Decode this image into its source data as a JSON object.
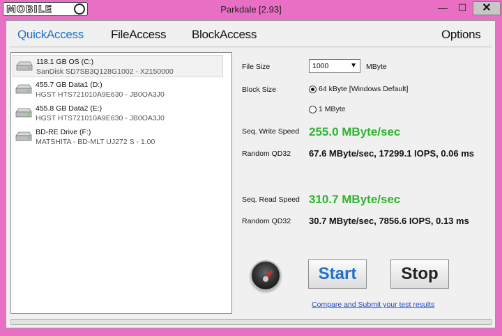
{
  "window": {
    "logo_text": "MOBILE",
    "title": "Parkdale [2.93]",
    "minimize": "—",
    "maximize": "☐",
    "close": "✕"
  },
  "tabs": [
    {
      "label": "QuickAccess",
      "active": true
    },
    {
      "label": "FileAccess"
    },
    {
      "label": "BlockAccess"
    },
    {
      "label": "Options"
    }
  ],
  "drives": [
    {
      "name": "118.1 GB OS (C:)",
      "model": "SanDisk SD7SB3Q128G1002 - X2150000",
      "selected": true
    },
    {
      "name": "455.7 GB Data1 (D:)",
      "model": "HGST HTS721010A9E630 - JB0OA3J0"
    },
    {
      "name": "455.8 GB Data2 (E:)",
      "model": "HGST HTS721010A9E630 - JB0OA3J0"
    },
    {
      "name": "BD-RE Drive (F:)",
      "model": "MATSHITA - BD-MLT UJ272 S - 1.00"
    }
  ],
  "settings": {
    "file_size_label": "File Size",
    "file_size_value": "1000",
    "file_size_unit": "MByte",
    "block_size_label": "Block Size",
    "block_options": [
      {
        "label": "64 kByte [Windows Default]",
        "selected": true
      },
      {
        "label": "1 MByte",
        "selected": false
      }
    ]
  },
  "results": {
    "write_label": "Seq. Write Speed",
    "write_value": "255.0 MByte/sec",
    "write_random_label": "Random QD32",
    "write_random_value": "67.6 MByte/sec, 17299.1 IOPS, 0.06 ms",
    "read_label": "Seq. Read Speed",
    "read_value": "310.7 MByte/sec",
    "read_random_label": "Random QD32",
    "read_random_value": "30.7 MByte/sec, 7856.6 IOPS, 0.13 ms"
  },
  "actions": {
    "start": "Start",
    "stop": "Stop",
    "submit_link": "Compare and Submit your test results"
  },
  "colors": {
    "accent": "#1f6fd0",
    "speed": "#2db52d",
    "frame": "#e96fc4"
  },
  "icons": [
    "hard-drive-icon",
    "speedometer-icon"
  ]
}
